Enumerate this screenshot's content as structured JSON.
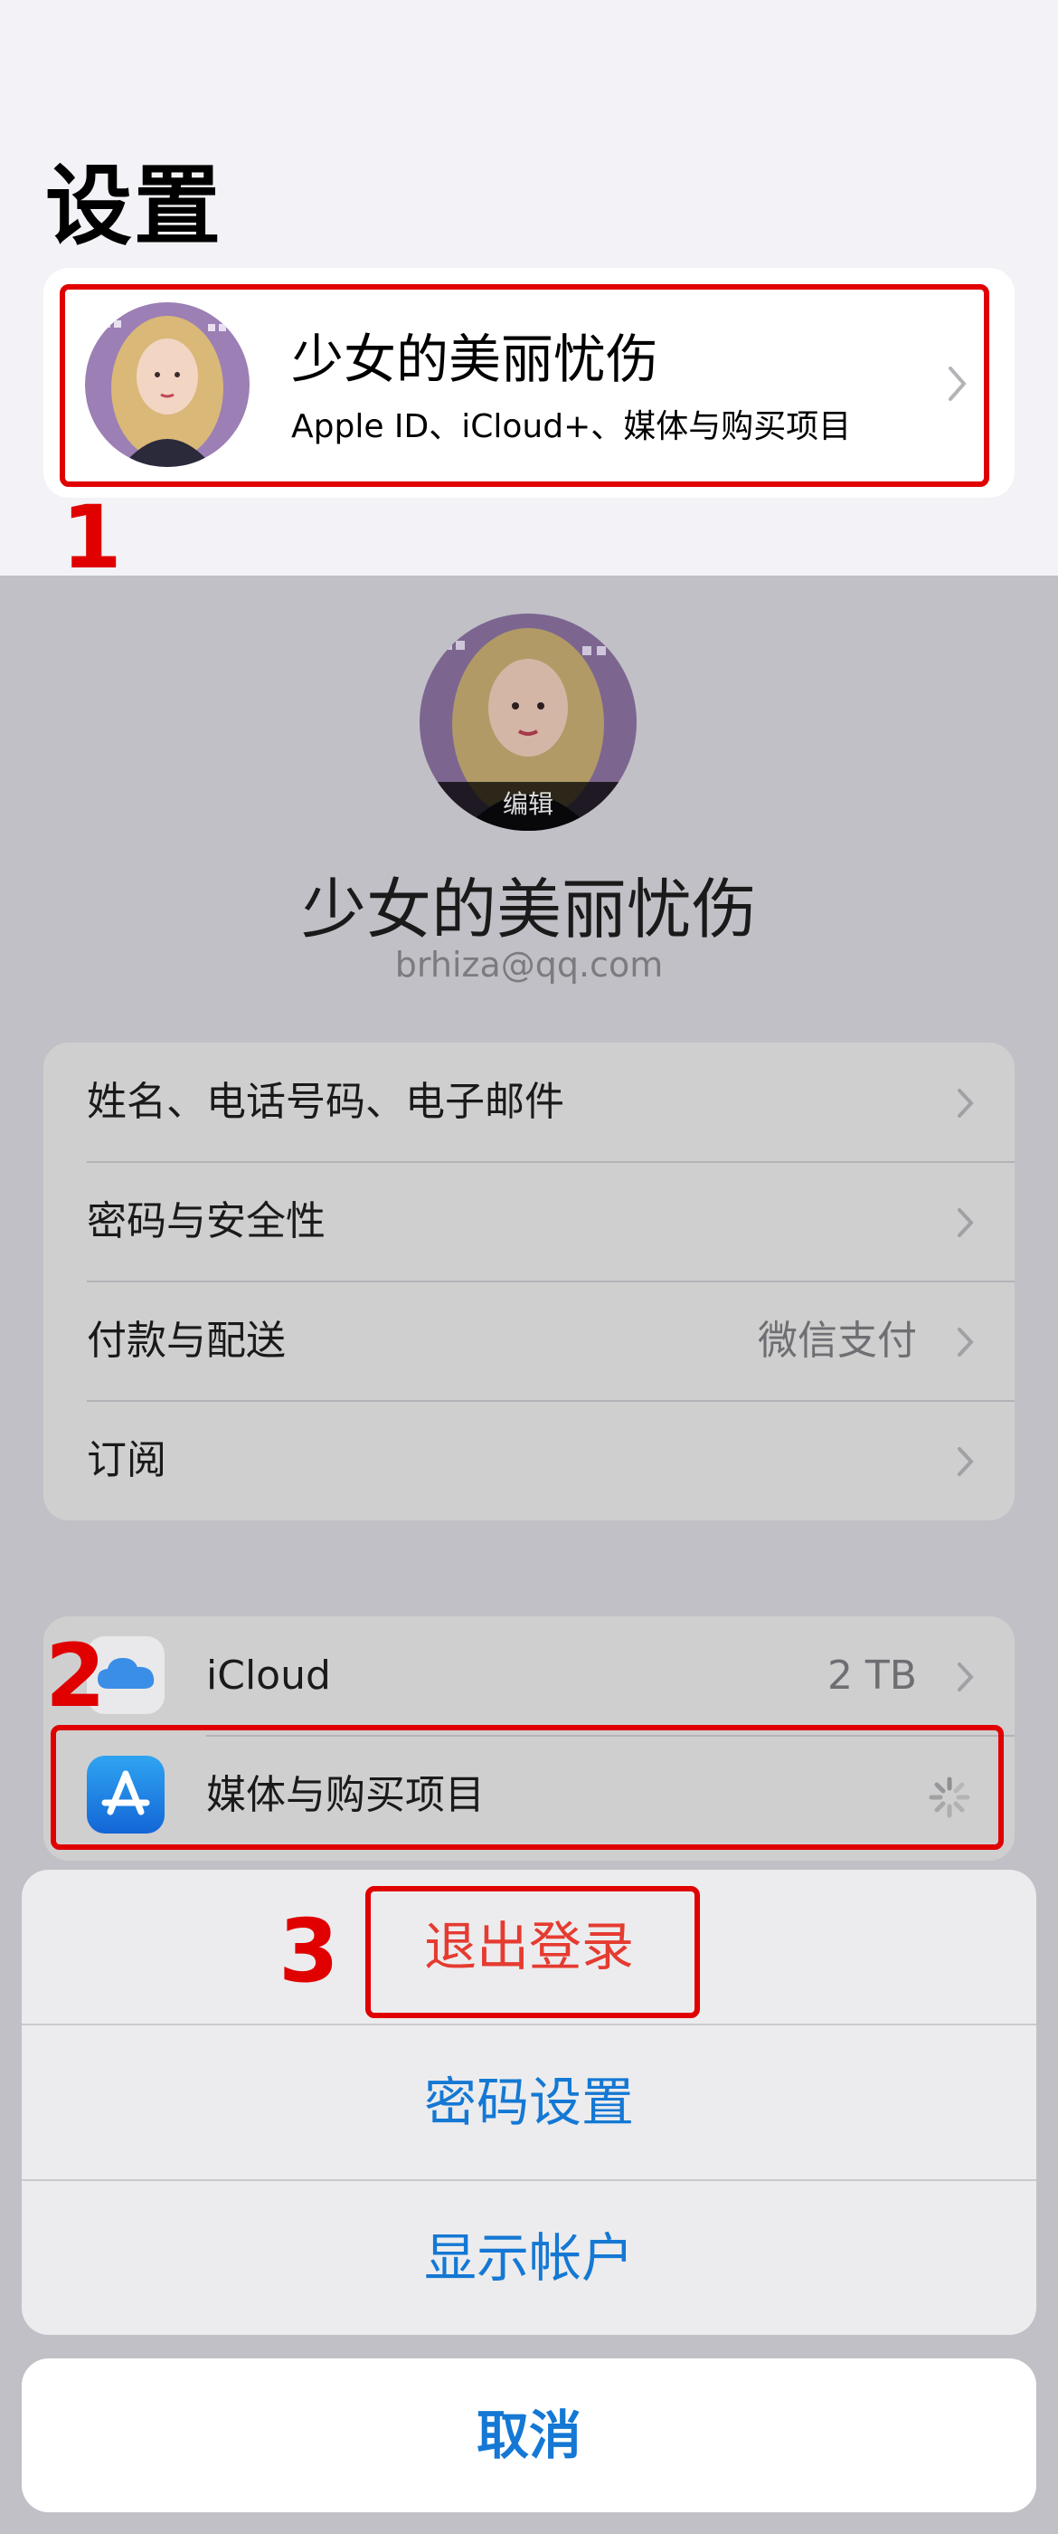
{
  "page_title": "设置",
  "profile": {
    "name": "少女的美丽忧伤",
    "subtitle": "Apple ID、iCloud+、媒体与购买项目"
  },
  "account_sheet": {
    "edit_label": "编辑",
    "name": "少女的美丽忧伤",
    "email": "brhiza@qq.com",
    "settings_rows": [
      {
        "label": "姓名、电话号码、电子邮件",
        "value": ""
      },
      {
        "label": "密码与安全性",
        "value": ""
      },
      {
        "label": "付款与配送",
        "value": "微信支付"
      },
      {
        "label": "订阅",
        "value": ""
      }
    ],
    "services_rows": [
      {
        "label": "iCloud",
        "value": "2 TB",
        "icon": "icloud-icon"
      },
      {
        "label": "媒体与购买项目",
        "value": "",
        "icon": "app-store-icon"
      }
    ]
  },
  "action_sheet": {
    "logout": "退出登录",
    "password_settings": "密码设置",
    "show_account": "显示帐户",
    "cancel": "取消"
  },
  "annotations": {
    "step1": "1",
    "step2": "2",
    "step3": "3"
  },
  "colors": {
    "annotation_red": "#e00000",
    "destructive_red": "#e53b30",
    "ios_blue": "#1478d4"
  }
}
